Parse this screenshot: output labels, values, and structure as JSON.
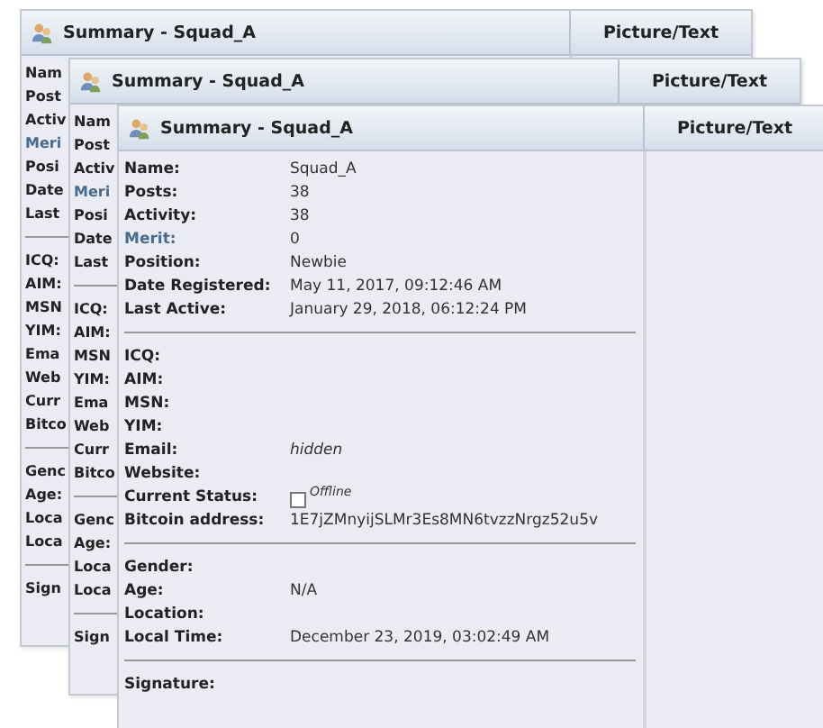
{
  "windows": [
    {
      "title": "Summary - Squad_A",
      "side_header": "Picture/Text",
      "sections": [
        [
          {
            "label": "Nam",
            "kind": "plain"
          },
          {
            "label": "Post",
            "kind": "plain"
          },
          {
            "label": "Activ",
            "kind": "plain"
          },
          {
            "label": "Meri",
            "kind": "link"
          },
          {
            "label": "Posi",
            "kind": "plain"
          },
          {
            "label": "Date",
            "kind": "plain"
          },
          {
            "label": "Last",
            "kind": "plain"
          }
        ],
        [
          {
            "label": "ICQ:",
            "kind": "plain"
          },
          {
            "label": "AIM:",
            "kind": "plain"
          },
          {
            "label": "MSN",
            "kind": "plain"
          },
          {
            "label": "YIM:",
            "kind": "plain"
          },
          {
            "label": "Ema",
            "kind": "plain"
          },
          {
            "label": "Web",
            "kind": "plain"
          },
          {
            "label": "Curr",
            "kind": "plain"
          },
          {
            "label": "Bitco",
            "kind": "plain"
          }
        ],
        [
          {
            "label": "Genc",
            "kind": "plain"
          },
          {
            "label": "Age:",
            "kind": "plain"
          },
          {
            "label": "Loca",
            "kind": "plain"
          },
          {
            "label": "Loca",
            "kind": "plain"
          }
        ],
        [
          {
            "label": "Sign",
            "kind": "plain"
          }
        ]
      ]
    },
    {
      "title": "Summary - Squad_A",
      "side_header": "Picture/Text",
      "sections": [
        [
          {
            "label": "Nam",
            "kind": "plain"
          },
          {
            "label": "Post",
            "kind": "plain"
          },
          {
            "label": "Activ",
            "kind": "plain"
          },
          {
            "label": "Meri",
            "kind": "link"
          },
          {
            "label": "Posi",
            "kind": "plain"
          },
          {
            "label": "Date",
            "kind": "plain"
          },
          {
            "label": "Last",
            "kind": "plain"
          }
        ],
        [
          {
            "label": "ICQ:",
            "kind": "plain"
          },
          {
            "label": "AIM:",
            "kind": "plain"
          },
          {
            "label": "MSN",
            "kind": "plain"
          },
          {
            "label": "YIM:",
            "kind": "plain"
          },
          {
            "label": "Ema",
            "kind": "plain"
          },
          {
            "label": "Web",
            "kind": "plain"
          },
          {
            "label": "Curr",
            "kind": "plain"
          },
          {
            "label": "Bitco",
            "kind": "plain"
          }
        ],
        [
          {
            "label": "Genc",
            "kind": "plain"
          },
          {
            "label": "Age:",
            "kind": "plain"
          },
          {
            "label": "Loca",
            "kind": "plain"
          },
          {
            "label": "Loca",
            "kind": "plain"
          }
        ],
        [
          {
            "label": "Sign",
            "kind": "plain"
          }
        ]
      ]
    },
    {
      "title": "Summary - Squad_A",
      "side_header": "Picture/Text",
      "sections": [
        [
          {
            "label": "Name:",
            "kind": "plain",
            "value": "Squad_A",
            "italic": false
          },
          {
            "label": "Posts:",
            "kind": "plain",
            "value": "38",
            "italic": false
          },
          {
            "label": "Activity:",
            "kind": "plain",
            "value": "38",
            "italic": false
          },
          {
            "label": "Merit:",
            "kind": "link",
            "value": "0",
            "italic": false
          },
          {
            "label": "Position:",
            "kind": "plain",
            "value": "Newbie",
            "italic": false
          },
          {
            "label": "Date Registered:",
            "kind": "plain",
            "value": "May 11, 2017, 09:12:46 AM",
            "italic": false
          },
          {
            "label": "Last Active:",
            "kind": "plain",
            "value": "January 29, 2018, 06:12:24 PM",
            "italic": false
          }
        ],
        [
          {
            "label": "ICQ:",
            "kind": "plain"
          },
          {
            "label": "AIM:",
            "kind": "plain"
          },
          {
            "label": "MSN:",
            "kind": "plain"
          },
          {
            "label": "YIM:",
            "kind": "plain"
          },
          {
            "label": "Email:",
            "kind": "plain",
            "value": "hidden",
            "italic": true
          },
          {
            "label": "Website:",
            "kind": "plain"
          },
          {
            "label": "Current Status:",
            "kind": "plain",
            "status": "Offline"
          },
          {
            "label": "Bitcoin address:",
            "kind": "plain",
            "value": "1E7jZMnyijSLMr3Es8MN6tvzzNrgz52u5v",
            "italic": false
          }
        ],
        [
          {
            "label": "Gender:",
            "kind": "plain"
          },
          {
            "label": "Age:",
            "kind": "plain",
            "value": "N/A",
            "italic": false
          },
          {
            "label": "Location:",
            "kind": "plain"
          },
          {
            "label": "Local Time:",
            "kind": "plain",
            "value": "December 23, 2019, 03:02:49 AM",
            "italic": false
          }
        ],
        [
          {
            "label": "Signature:",
            "kind": "plain"
          }
        ]
      ]
    }
  ]
}
